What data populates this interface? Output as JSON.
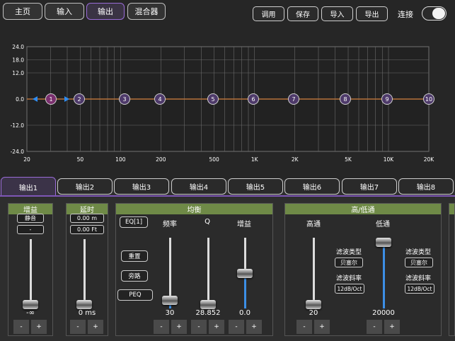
{
  "nav": {
    "tabs": [
      {
        "label": "主页"
      },
      {
        "label": "输入"
      },
      {
        "label": "输出"
      },
      {
        "label": "混合器"
      }
    ],
    "active": "输出"
  },
  "actions": [
    {
      "label": "调用"
    },
    {
      "label": "保存"
    },
    {
      "label": "导入"
    },
    {
      "label": "导出"
    }
  ],
  "connection": {
    "label": "连接",
    "enabled": false
  },
  "graph": {
    "y_ticks": [
      "24.0",
      "18.0",
      "12.0",
      "0.0",
      "-12.0",
      "-24.0"
    ],
    "x_ticks": [
      "20",
      "50",
      "100",
      "200",
      "500",
      "1K",
      "2K",
      "5K",
      "10K",
      "20K"
    ],
    "bands": [
      "1",
      "2",
      "3",
      "4",
      "5",
      "6",
      "7",
      "8",
      "9",
      "10"
    ],
    "colors": {
      "curve": "#b8733a",
      "bandfill": "#4e3a6a",
      "selected": "#7a2f6e",
      "arrow": "#2f8cf0"
    }
  },
  "output_tabs": [
    "输出1",
    "输出2",
    "输出3",
    "输出4",
    "输出5",
    "输出6",
    "输出7",
    "输出8"
  ],
  "gain": {
    "title": "增益",
    "mute": "静音",
    "phase": "-",
    "value": "-∞"
  },
  "delay": {
    "title": "延时",
    "meters": "0.00 m",
    "feet": "0.00 Ft",
    "value": "0 ms"
  },
  "eq": {
    "title": "均衡",
    "band": "EQ[1]",
    "freq_label": "频率",
    "q_label": "Q",
    "gain_label": "增益",
    "reset": "重置",
    "bypass": "旁路",
    "peq": "PEQ",
    "freq": "30",
    "q": "28.852",
    "gain": "0.0"
  },
  "filter": {
    "title": "高/低通",
    "hp_label": "高通",
    "lp_label": "低通",
    "type_label": "滤波类型",
    "type_value": "贝塞尔",
    "slope_label": "滤波斜率",
    "slope_value": "12dB/Oct",
    "hp_value": "20",
    "lp_value": "20000"
  },
  "stepper": {
    "minus": "-",
    "plus": "+"
  }
}
